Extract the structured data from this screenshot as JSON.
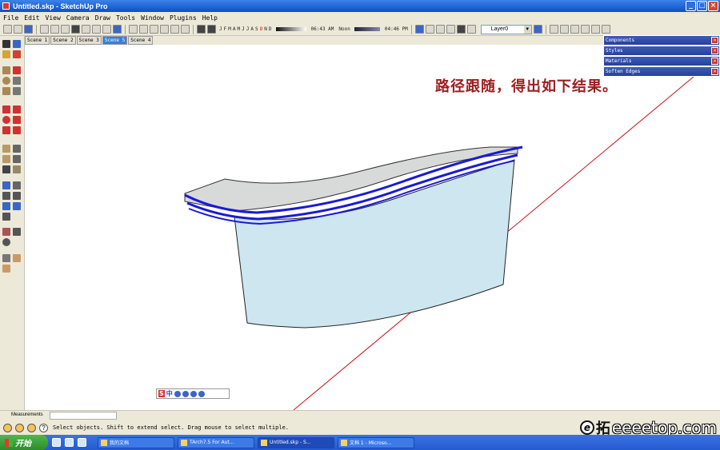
{
  "window": {
    "title": "Untitled.skp - SketchUp Pro"
  },
  "menu": [
    "File",
    "Edit",
    "View",
    "Camera",
    "Draw",
    "Tools",
    "Window",
    "Plugins",
    "Help"
  ],
  "shadows": {
    "months": [
      "J",
      "F",
      "M",
      "A",
      "M",
      "J",
      "J",
      "A",
      "S",
      "O",
      "N",
      "D"
    ],
    "time_start": "06:43 AM",
    "noon": "Noon",
    "time_end": "04:46 PM"
  },
  "layer": {
    "value": "Layer0"
  },
  "scenes": [
    {
      "label": "Scene 1",
      "active": false
    },
    {
      "label": "Scene 2",
      "active": false
    },
    {
      "label": "Scene 3",
      "active": false
    },
    {
      "label": "Scene 5",
      "active": true
    },
    {
      "label": "Scene 4",
      "active": false
    }
  ],
  "tray": [
    {
      "label": "Components"
    },
    {
      "label": "Styles"
    },
    {
      "label": "Materials"
    },
    {
      "label": "Soften Edges"
    }
  ],
  "annotation": "路径跟随，得出如下结果。",
  "ime": {
    "s": "S",
    "zh": "中"
  },
  "measurements": {
    "label": "Measurements",
    "value": ""
  },
  "status": {
    "text": "Select objects. Shift to extend select. Drag mouse to select multiple."
  },
  "taskbar": {
    "start": "开始",
    "tasks": [
      {
        "label": "我的文档",
        "active": false
      },
      {
        "label": "TArch7.5 For Aut...",
        "active": false
      },
      {
        "label": "Untitled.skp - S...",
        "active": true
      },
      {
        "label": "文档 1 - Microso...",
        "active": false
      }
    ]
  },
  "watermark": {
    "logo": "e",
    "zh": "拓",
    "site": "eeeetop.com"
  },
  "colors": {
    "face": "#cde6f0",
    "edge_blue": "#1a1ad6",
    "annotation": "#9b1f1f",
    "axis_red": "#c8141e"
  }
}
